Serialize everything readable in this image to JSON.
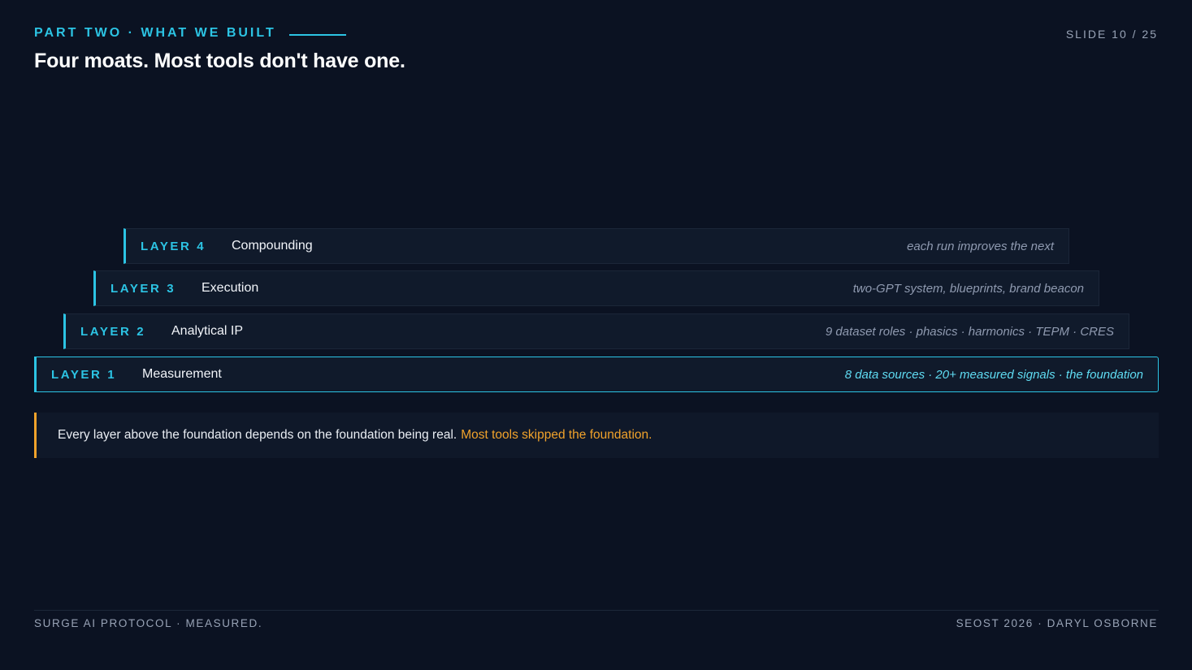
{
  "header": {
    "eyebrow": "PART TWO · WHAT WE BUILT",
    "slide_number": "SLIDE 10 / 25",
    "title": "Four moats. Most tools don't have one."
  },
  "layers": [
    {
      "tag": "LAYER 1",
      "name": "Measurement",
      "description": "8 data sources · 20+ measured signals · the foundation",
      "highlighted": true
    },
    {
      "tag": "LAYER 2",
      "name": "Analytical IP",
      "description": "9 dataset roles · phasics · harmonics · TEPM · CRES",
      "highlighted": false
    },
    {
      "tag": "LAYER 3",
      "name": "Execution",
      "description": "two-GPT system, blueprints, brand beacon",
      "highlighted": false
    },
    {
      "tag": "LAYER 4",
      "name": "Compounding",
      "description": "each run improves the next",
      "highlighted": false
    }
  ],
  "callout": {
    "text": "Every layer above the foundation depends on the foundation being real.",
    "accent_text": "Most tools skipped the foundation."
  },
  "footer": {
    "left": "SURGE AI PROTOCOL · MEASURED.",
    "right": "SEOST 2026 · DARYL OSBORNE"
  },
  "colors": {
    "background": "#0b1222",
    "accent_cyan": "#2cc4e4",
    "accent_orange": "#f0a22b",
    "panel": "#101a2b"
  }
}
